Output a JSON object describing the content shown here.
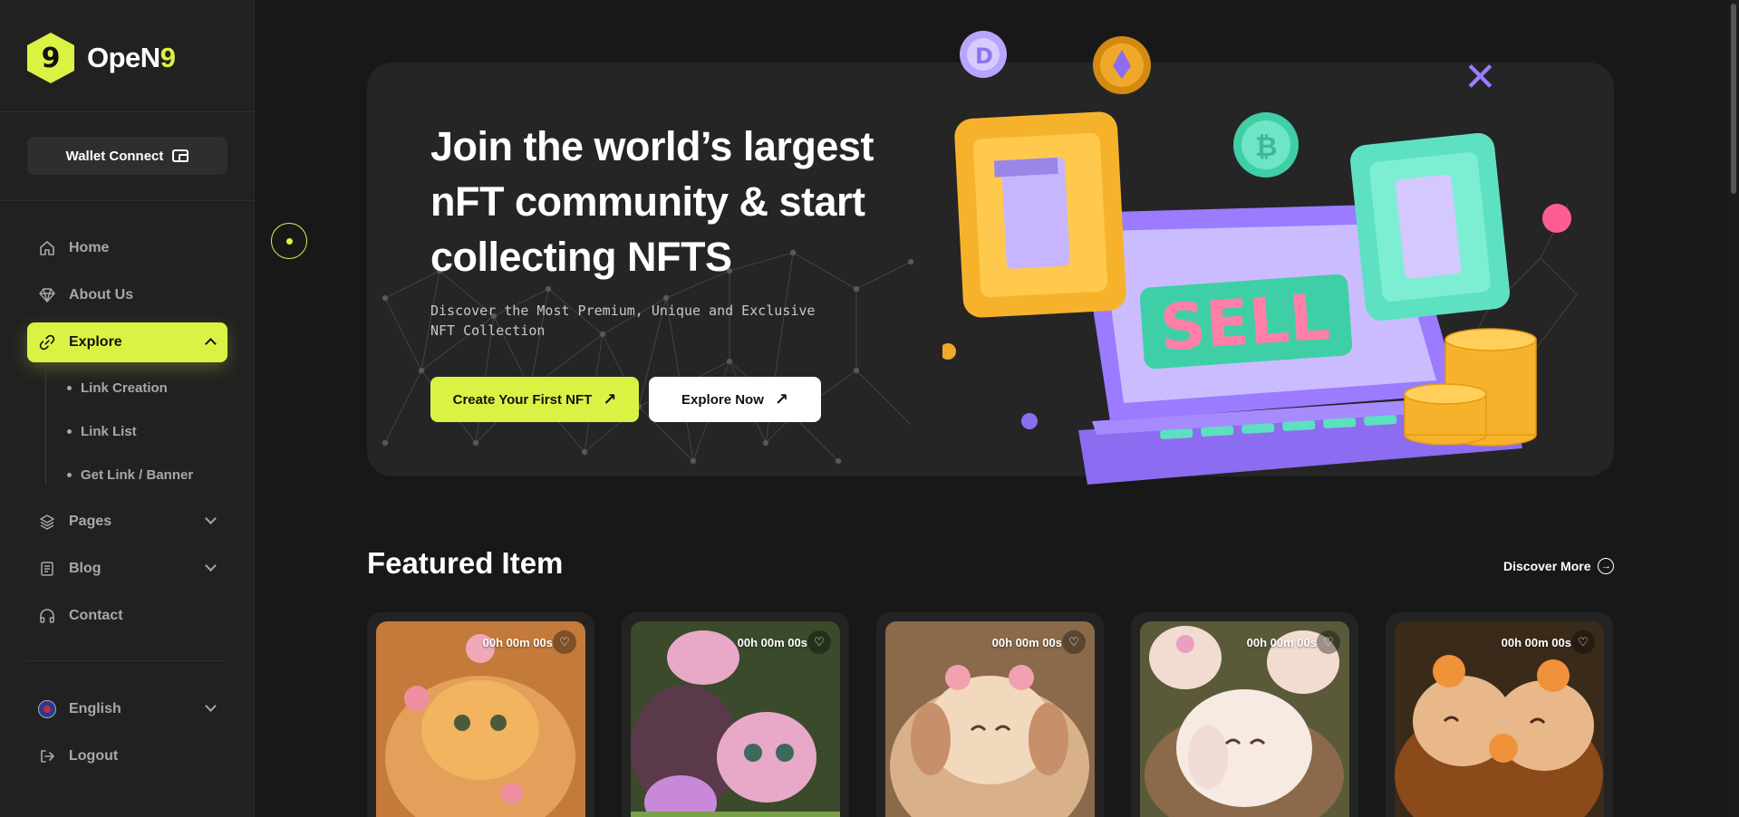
{
  "brand": {
    "logo_glyph": "9",
    "name_main": "OpeN",
    "name_accent": "9",
    "accent_color": "#dbf244"
  },
  "sidebar": {
    "wallet_label": "Wallet Connect",
    "items": [
      {
        "label": "Home",
        "icon": "home-icon"
      },
      {
        "label": "About Us",
        "icon": "diamond-icon"
      },
      {
        "label": "Explore",
        "icon": "link-icon"
      },
      {
        "label": "Pages",
        "icon": "layers-icon"
      },
      {
        "label": "Blog",
        "icon": "document-icon"
      },
      {
        "label": "Contact",
        "icon": "headphones-icon"
      }
    ],
    "sub_items": [
      "Link Creation",
      "Link List",
      "Get Link / Banner"
    ],
    "language": "English",
    "logout": "Logout"
  },
  "hero": {
    "title": "Join the world’s largest nFT community & start collecting NFTS",
    "subtitle": "Discover the Most Premium, Unique and Exclusive NFT Collection",
    "primary_button": "Create Your First NFT",
    "secondary_button": "Explore Now",
    "illustration_text": "SELL"
  },
  "featured": {
    "title": "Featured Item",
    "discover_label": "Discover More",
    "cards": [
      {
        "timer": "00h 00m 00s"
      },
      {
        "timer": "00h 00m 00s"
      },
      {
        "timer": "00h 00m 00s"
      },
      {
        "timer": "00h 00m 00s"
      },
      {
        "timer": "00h 00m 00s"
      }
    ]
  }
}
